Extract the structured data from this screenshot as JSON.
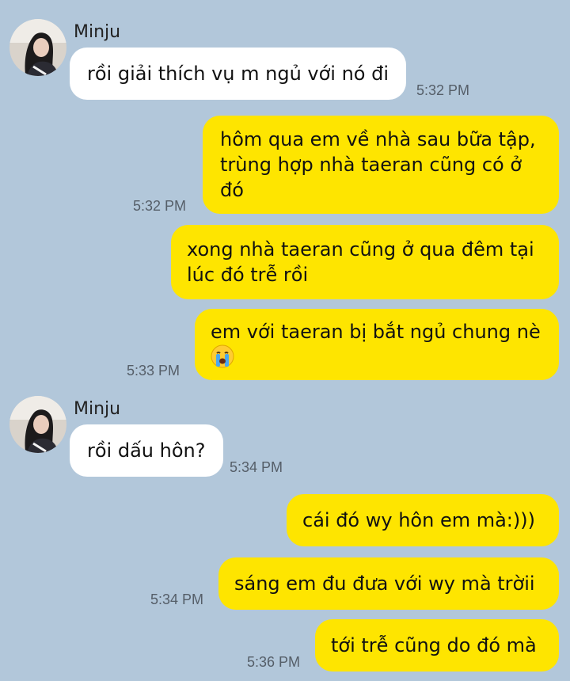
{
  "messages": [
    {
      "sender": "Minju",
      "text": "rồi giải thích vụ m ngủ với nó đi",
      "time": "5:32 PM"
    },
    {
      "lines": [
        "hôm qua em về nhà sau bữa tập,",
        "trùng hợp nhà taeran cũng có ở",
        "đó"
      ],
      "time": "5:32 PM"
    },
    {
      "lines": [
        "xong nhà taeran cũng ở qua đêm tại",
        "lúc đó trễ rồi"
      ]
    },
    {
      "text": "em với taeran bị bắt ngủ chung nè",
      "emoji": "loudly-crying-face-icon",
      "time": "5:33 PM"
    },
    {
      "sender": "Minju",
      "text": "rồi dấu hôn?",
      "time": "5:34 PM"
    },
    {
      "text": "cái đó wy hôn em mà:)))"
    },
    {
      "text": "sáng em đu đưa với wy mà trờii",
      "time": "5:34 PM"
    },
    {
      "text": "tới trễ cũng do đó mà",
      "time": "5:36 PM"
    }
  ],
  "colors": {
    "background": "#b2c7da",
    "incoming_bubble": "#ffffff",
    "outgoing_bubble": "#fee500"
  }
}
